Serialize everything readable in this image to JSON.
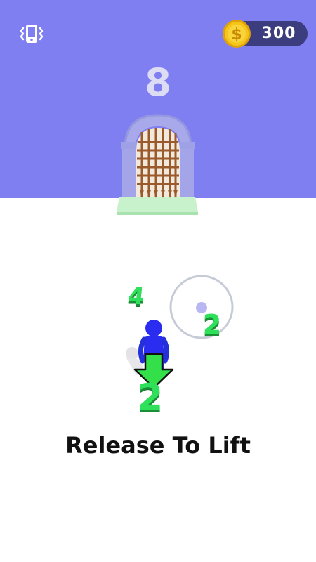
{
  "hud": {
    "vibrate_icon": "phone-vibrate-icon",
    "coins": "300",
    "coin_icon": "dollar-coin-icon",
    "coin_symbol": "$"
  },
  "level": {
    "number": "8"
  },
  "scene": {
    "gate_icon": "portcullis-gate-icon",
    "player_icon": "blue-stickman-icon",
    "floating_numbers": [
      {
        "value": "4"
      },
      {
        "value": "2"
      },
      {
        "value": "2"
      }
    ]
  },
  "instruction": "Release To Lift",
  "colors": {
    "sky": "#7f7ff2",
    "ground": "#ffffff",
    "coin_pill": "#3b3d7e",
    "coin_gold": "#f5c518",
    "number_green": "#2ee05a",
    "player_blue": "#2a2cf0",
    "arrow_green": "#33e04a"
  }
}
